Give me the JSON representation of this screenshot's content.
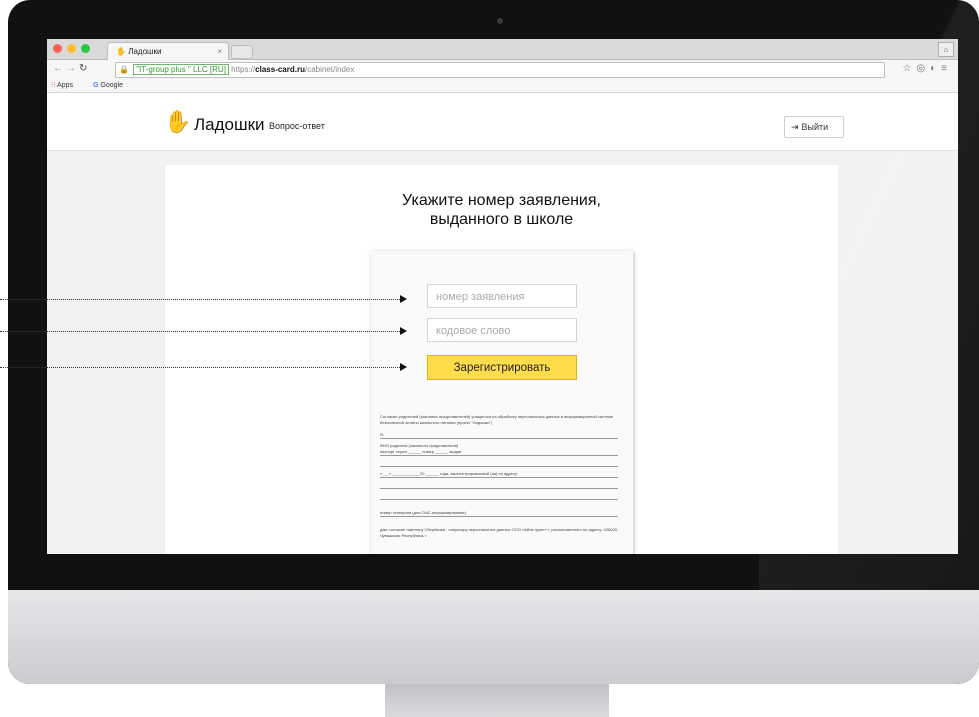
{
  "browser": {
    "tab_title": "Ладошки",
    "tab_close": "×",
    "cert_label": "\"IT-group plus \" LLC [RU]",
    "url_scheme": "https://",
    "url_host": "class-card.ru",
    "url_path": "/cabinet/index",
    "bookmarks": [
      {
        "label": "Apps"
      },
      {
        "label": "Google"
      }
    ],
    "colors": {
      "close": "#ff5f57",
      "minimize": "#febc2e",
      "maximize": "#28c840"
    }
  },
  "site": {
    "logo_text": "Ладошки",
    "nav_link": "Вопрос-ответ",
    "logout_label": "Выйти",
    "brand_color": "#fedc4a"
  },
  "form": {
    "heading_line1": "Укажите номер заявления,",
    "heading_line2": "выданного в школе",
    "application_number_placeholder": "номер заявления",
    "code_word_placeholder": "кодовое слово",
    "submit_label": "Зарегистрировать"
  },
  "document": {
    "intro": "Согласие родителей (законных представителей) учащегося на обработку персональных данных в информационной системе безналичной оплаты школьного питания (проект \"Ладошки\")",
    "line_ya": "Я,",
    "line_fio": "ФИО родителя (законного представителя)",
    "line_passport": "паспорт серия ______ номер ______ выдан",
    "line_date": "« __ » ____________ 20 ______ года, зарегистрированный (ая) по адресу:",
    "line_phone": "номер телефона (для СМС-информирования)",
    "line_consent": "даю согласие партнеру Сбербанка - оператору персональных данных ООО «Айти-групп+», расположенного по адресу: 428000, Чувашская Республика, г."
  }
}
